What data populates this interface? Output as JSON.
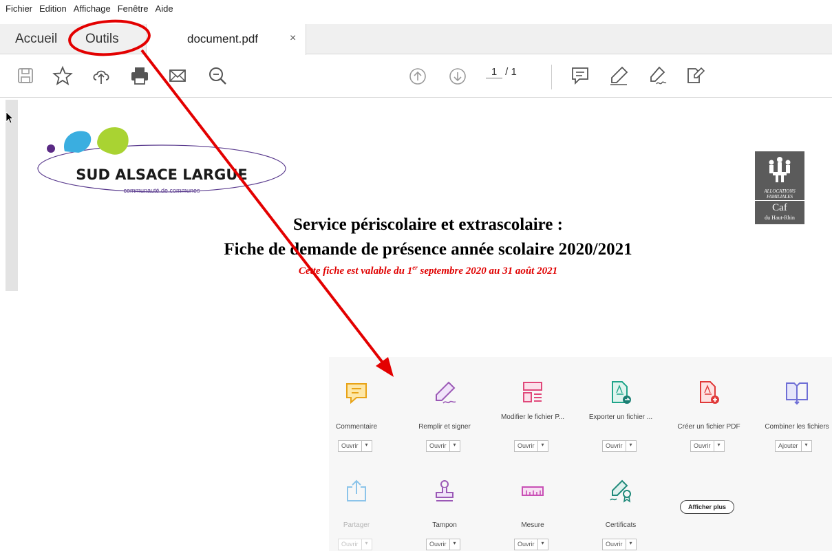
{
  "menu": {
    "items": [
      "Fichier",
      "Edition",
      "Affichage",
      "Fenêtre",
      "Aide"
    ]
  },
  "tabs": {
    "home": "Accueil",
    "tools": "Outils",
    "document": "document.pdf",
    "close": "×"
  },
  "toolbar": {
    "icons": [
      "save-icon",
      "bookmark-star-icon",
      "cloud-upload-icon",
      "print-icon",
      "email-icon",
      "zoom-search-icon",
      "previous-page-icon",
      "next-page-icon",
      "comment-icon",
      "highlight-pen-icon",
      "sign-icon",
      "fill-sign-icon"
    ],
    "page_current": "1",
    "page_total": "/ 1"
  },
  "document": {
    "logo_name": "SUD ALSACE LARGUE",
    "logo_sub": "communauté de communes",
    "caf_line1": "ALLOCATIONS",
    "caf_line2": "FAMILIALES",
    "caf_name": "Caf",
    "caf_region": "du Haut-Rhin",
    "title_line1": "Service périscolaire et extrascolaire :",
    "title_line2": "Fiche de demande de présence année scolaire 2020/2021",
    "subtitle_before": "Cette fiche est valable du 1",
    "subtitle_sup": "er",
    "subtitle_after": " septembre 2020 au 31 août 2021"
  },
  "tools": {
    "items": [
      {
        "label": "Commentaire",
        "button": "Ouvrir",
        "icon": "comment-tool-icon",
        "color": "#e8a317"
      },
      {
        "label": "Remplir et signer",
        "button": "Ouvrir",
        "icon": "fill-sign-tool-icon",
        "color": "#9b59b6"
      },
      {
        "label": "Modifier le fichier P...",
        "button": "Ouvrir",
        "icon": "edit-pdf-tool-icon",
        "color": "#e0487a"
      },
      {
        "label": "Exporter un fichier ...",
        "button": "Ouvrir",
        "icon": "export-pdf-tool-icon",
        "color": "#1fa58a"
      },
      {
        "label": "Créer un fichier PDF",
        "button": "Ouvrir",
        "icon": "create-pdf-tool-icon",
        "color": "#e03a3a"
      },
      {
        "label": "Combiner les fichiers",
        "button": "Ajouter",
        "icon": "combine-files-tool-icon",
        "color": "#6f6fd6"
      },
      {
        "label": "Partager",
        "button": "Ouvrir",
        "icon": "share-tool-icon",
        "color": "#8cc4ea"
      },
      {
        "label": "Tampon",
        "button": "Ouvrir",
        "icon": "stamp-tool-icon",
        "color": "#9b59b6"
      },
      {
        "label": "Mesure",
        "button": "Ouvrir",
        "icon": "measure-tool-icon",
        "color": "#c84fb5"
      },
      {
        "label": "Certificats",
        "button": "Ouvrir",
        "icon": "certificates-tool-icon",
        "color": "#1f8a7a"
      }
    ],
    "dropdown_arrow": "▾",
    "show_more": "Afficher plus"
  },
  "colors": {
    "annotation_red": "#e30000",
    "accent": "#e8a317"
  }
}
